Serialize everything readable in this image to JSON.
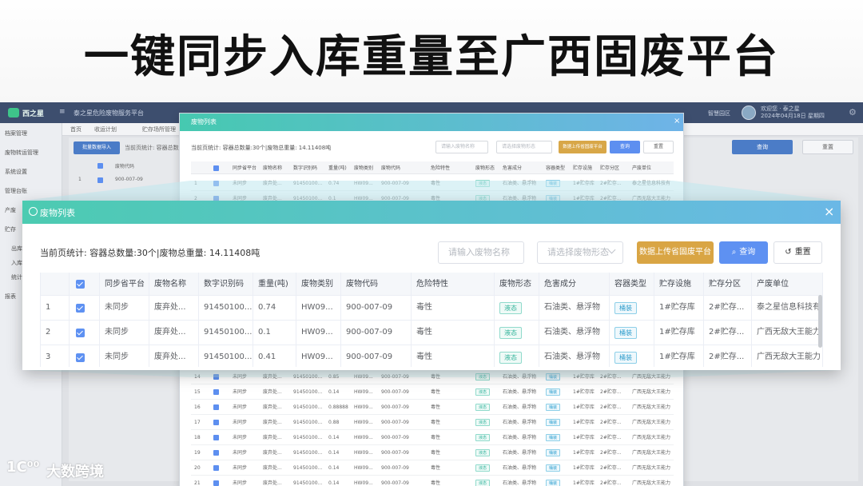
{
  "banner": {
    "title": "一键同步入库重量至广西固废平台"
  },
  "bg_app": {
    "logo_text": "西之星",
    "collapse_glyph": "≡",
    "system_name": "泰之星危险废物服务平台",
    "help_text": "智慧园区",
    "user_line1": "欢迎您 · 泰之星",
    "user_line2": "2024年04月18日 星期四",
    "gear_glyph": "⚙",
    "nav": [
      "档案管理",
      "废物转运管理",
      "系统设置",
      "管理台账",
      "产废",
      "贮存",
      "出库",
      "入库",
      "统计",
      "报表"
    ],
    "tabs": [
      "首页",
      "收运计划",
      "贮存场所管理"
    ],
    "left_button": "批量数据导入",
    "left_stat": "当前页统计: 容器总数量",
    "right_query": "查询",
    "right_reset": "重置",
    "head_col": "废物代码",
    "row1_index": "1",
    "row1_code": "900-007-09"
  },
  "small_modal": {
    "title": "废物列表",
    "close_glyph": "×",
    "stats": "当前页统计: 容器总数量:30个|废物总重量: 14.11408吨",
    "name_placeholder": "请输入废物名称",
    "form_placeholder": "请选择废物形态",
    "upload_label": "数据上传省固废平台",
    "query_label": "查询",
    "reset_label": "重置",
    "columns": [
      "同步省平台",
      "废物名称",
      "数字识别码",
      "重量(吨)",
      "废物类别",
      "废物代码",
      "危险特性",
      "废物形态",
      "危害成分",
      "容器类型",
      "贮存设施",
      "贮存分区",
      "产废单位"
    ],
    "rows": [
      {
        "idx": "1",
        "sync": "未同步",
        "name": "废弃处...",
        "code": "91450100...",
        "weight": "0.74",
        "cat": "HW09...",
        "wcode": "900-007-09",
        "hazard": "毒性",
        "form": "液态",
        "comp": "石油类、悬浮物",
        "cont": "桶装",
        "fac": "1#贮存库",
        "zone": "2#贮存...",
        "unit": "泰之星信息科技有"
      },
      {
        "idx": "2",
        "sync": "未同步",
        "name": "废弃处...",
        "code": "91450100...",
        "weight": "0.1",
        "cat": "HW09...",
        "wcode": "900-007-09",
        "hazard": "毒性",
        "form": "液态",
        "comp": "石油类、悬浮物",
        "cont": "桶装",
        "fac": "1#贮存库",
        "zone": "2#贮存...",
        "unit": "广西无敌大王能力"
      },
      {
        "idx": "14",
        "sync": "未同步",
        "name": "废弃处...",
        "code": "91450100...",
        "weight": "0.85",
        "cat": "HW09...",
        "wcode": "900-007-09",
        "hazard": "毒性",
        "form": "液态",
        "comp": "石油类、悬浮物",
        "cont": "桶装",
        "fac": "1#贮存库",
        "zone": "2#贮存...",
        "unit": "广西无敌大王能力"
      },
      {
        "idx": "15",
        "sync": "未同步",
        "name": "废弃处...",
        "code": "91450100...",
        "weight": "0.14",
        "cat": "HW09...",
        "wcode": "900-007-09",
        "hazard": "毒性",
        "form": "液态",
        "comp": "石油类、悬浮物",
        "cont": "桶装",
        "fac": "1#贮存库",
        "zone": "2#贮存...",
        "unit": "广西无敌大王能力"
      },
      {
        "idx": "16",
        "sync": "未同步",
        "name": "废弃处...",
        "code": "91450100...",
        "weight": "0.88888",
        "cat": "HW09...",
        "wcode": "900-007-09",
        "hazard": "毒性",
        "form": "液态",
        "comp": "石油类、悬浮物",
        "cont": "桶装",
        "fac": "1#贮存库",
        "zone": "2#贮存...",
        "unit": "广西无敌大王能力"
      },
      {
        "idx": "17",
        "sync": "未同步",
        "name": "废弃处...",
        "code": "91450100...",
        "weight": "0.88",
        "cat": "HW09...",
        "wcode": "900-007-09",
        "hazard": "毒性",
        "form": "液态",
        "comp": "石油类、悬浮物",
        "cont": "桶装",
        "fac": "1#贮存库",
        "zone": "2#贮存...",
        "unit": "广西无敌大王能力"
      },
      {
        "idx": "18",
        "sync": "未同步",
        "name": "废弃处...",
        "code": "91450100...",
        "weight": "0.14",
        "cat": "HW09...",
        "wcode": "900-007-09",
        "hazard": "毒性",
        "form": "液态",
        "comp": "石油类、悬浮物",
        "cont": "桶装",
        "fac": "1#贮存库",
        "zone": "2#贮存...",
        "unit": "广西无敌大王能力"
      },
      {
        "idx": "19",
        "sync": "未同步",
        "name": "废弃处...",
        "code": "91450100...",
        "weight": "0.14",
        "cat": "HW09...",
        "wcode": "900-007-09",
        "hazard": "毒性",
        "form": "液态",
        "comp": "石油类、悬浮物",
        "cont": "桶装",
        "fac": "1#贮存库",
        "zone": "2#贮存...",
        "unit": "广西无敌大王能力"
      },
      {
        "idx": "20",
        "sync": "未同步",
        "name": "废弃处...",
        "code": "91450100...",
        "weight": "0.14",
        "cat": "HW09...",
        "wcode": "900-007-09",
        "hazard": "毒性",
        "form": "液态",
        "comp": "石油类、悬浮物",
        "cont": "桶装",
        "fac": "1#贮存库",
        "zone": "2#贮存...",
        "unit": "广西无敌大王能力"
      },
      {
        "idx": "21",
        "sync": "未同步",
        "name": "废弃处...",
        "code": "91450100...",
        "weight": "0.14",
        "cat": "HW09...",
        "wcode": "900-007-09",
        "hazard": "毒性",
        "form": "液态",
        "comp": "石油类、悬浮物",
        "cont": "桶装",
        "fac": "1#贮存库",
        "zone": "2#贮存...",
        "unit": "广西无敌大王能力"
      }
    ]
  },
  "zoom_modal": {
    "title": "废物列表",
    "close_glyph": "×",
    "stats": "当前页统计: 容器总数量:30个|废物总重量:  14.11408吨",
    "name_placeholder": "请输入废物名称",
    "form_placeholder": "请选择废物形态",
    "upload_label": "数据上传省固废平台",
    "query_icon": "⌕",
    "query_label": "查询",
    "reset_icon": "↺",
    "reset_label": "重置",
    "columns": [
      "同步省平台",
      "废物名称",
      "数字识别码",
      "重量(吨)",
      "废物类别",
      "废物代码",
      "危险特性",
      "废物形态",
      "危害成分",
      "容器类型",
      "贮存设施",
      "贮存分区",
      "产废单位"
    ],
    "rows": [
      {
        "idx": "1",
        "sync": "未同步",
        "name": "废弃处...",
        "code": "91450100...",
        "weight": "0.74",
        "cat": "HW09...",
        "wcode": "900-007-09",
        "hazard": "毒性",
        "form": "液态",
        "comp": "石油类、悬浮物",
        "cont": "桶装",
        "fac": "1#贮存库",
        "zone": "2#贮存...",
        "unit": "泰之星信息科技有"
      },
      {
        "idx": "2",
        "sync": "未同步",
        "name": "废弃处...",
        "code": "91450100...",
        "weight": "0.1",
        "cat": "HW09...",
        "wcode": "900-007-09",
        "hazard": "毒性",
        "form": "液态",
        "comp": "石油类、悬浮物",
        "cont": "桶装",
        "fac": "1#贮存库",
        "zone": "2#贮存...",
        "unit": "广西无敌大王能力"
      },
      {
        "idx": "3",
        "sync": "未同步",
        "name": "废弃处...",
        "code": "91450100...",
        "weight": "0.41",
        "cat": "HW09...",
        "wcode": "900-007-09",
        "hazard": "毒性",
        "form": "液态",
        "comp": "石油类、悬浮物",
        "cont": "桶装",
        "fac": "1#贮存库",
        "zone": "2#贮存...",
        "unit": "广西无敌大王能力"
      }
    ]
  },
  "watermark": {
    "mark": "1C⁰⁰",
    "text": "大数跨境"
  },
  "colors": {
    "header_start": "#4ccbb1",
    "header_end": "#6ab8e6",
    "upload_btn": "#d9a544",
    "query_btn": "#5e91f2",
    "topbar": "#3d4e6e"
  }
}
